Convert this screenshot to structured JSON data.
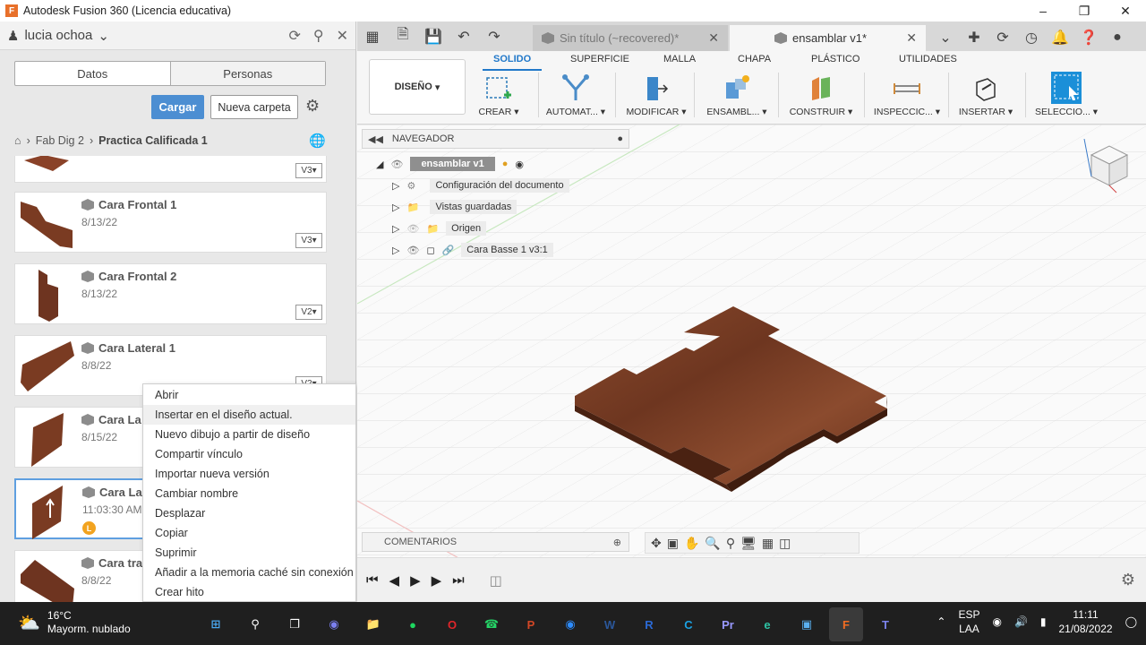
{
  "window": {
    "title": "Autodesk Fusion 360 (Licencia educativa)"
  },
  "left_panel": {
    "user": "lucia ochoa",
    "tabs": [
      "Datos",
      "Personas"
    ],
    "upload_button": "Cargar",
    "new_folder_button": "Nueva carpeta",
    "breadcrumb": [
      "Fab Dig 2",
      "Practica Calificada 1"
    ],
    "files": [
      {
        "name": "",
        "date": "",
        "version": "V3"
      },
      {
        "name": "Cara Frontal 1",
        "date": "8/13/22",
        "version": "V3"
      },
      {
        "name": "Cara Frontal 2",
        "date": "8/13/22",
        "version": "V2"
      },
      {
        "name": "Cara Lateral 1",
        "date": "8/8/22",
        "version": "V2"
      },
      {
        "name": "Cara La",
        "date": "8/15/22",
        "version": ""
      },
      {
        "name": "Cara La",
        "date": "11:03:30 AM",
        "version": "",
        "badge": "L"
      },
      {
        "name": "Cara tra",
        "date": "8/8/22",
        "version": ""
      }
    ]
  },
  "context_menu": {
    "items": [
      "Abrir",
      "Insertar en el diseño actual.",
      "Nuevo dibujo a partir de diseño",
      "Compartir vínculo",
      "Importar nueva versión",
      "Cambiar nombre",
      "Desplazar",
      "Copiar",
      "Suprimir",
      "Añadir a la memoria caché sin conexión",
      "Crear hito"
    ],
    "hovered_index": 1
  },
  "doc_tabs": [
    {
      "label": "Sin título (~recovered)*",
      "active": false
    },
    {
      "label": "ensamblar v1*",
      "active": true
    }
  ],
  "toolbar": {
    "workspace": "DISEÑO",
    "tabs": [
      "SOLIDO",
      "SUPERFICIE",
      "MALLA",
      "CHAPA",
      "PLÁSTICO",
      "UTILIDADES"
    ],
    "active_tab": "SOLIDO",
    "tools": [
      "CREAR",
      "AUTOMAT...",
      "MODIFICAR",
      "ENSAMBL...",
      "CONSTRUIR",
      "INSPECCIC...",
      "INSERTAR",
      "SELECCIO..."
    ]
  },
  "browser": {
    "header": "NAVEGADOR",
    "root": "ensamblar v1",
    "items": [
      "Configuración del documento",
      "Vistas guardadas",
      "Origen",
      "Cara Basse 1 v3:1"
    ]
  },
  "comments": {
    "label": "COMENTARIOS"
  },
  "taskbar": {
    "weather_temp": "16°C",
    "weather_desc": "Mayorm. nublado",
    "lang_1": "ESP",
    "lang_2": "LAA",
    "time": "11:11",
    "date": "21/08/2022"
  },
  "colors": {
    "accent": "#2178c9",
    "button": "#4c8ed2",
    "wood": "#7a3b22"
  }
}
